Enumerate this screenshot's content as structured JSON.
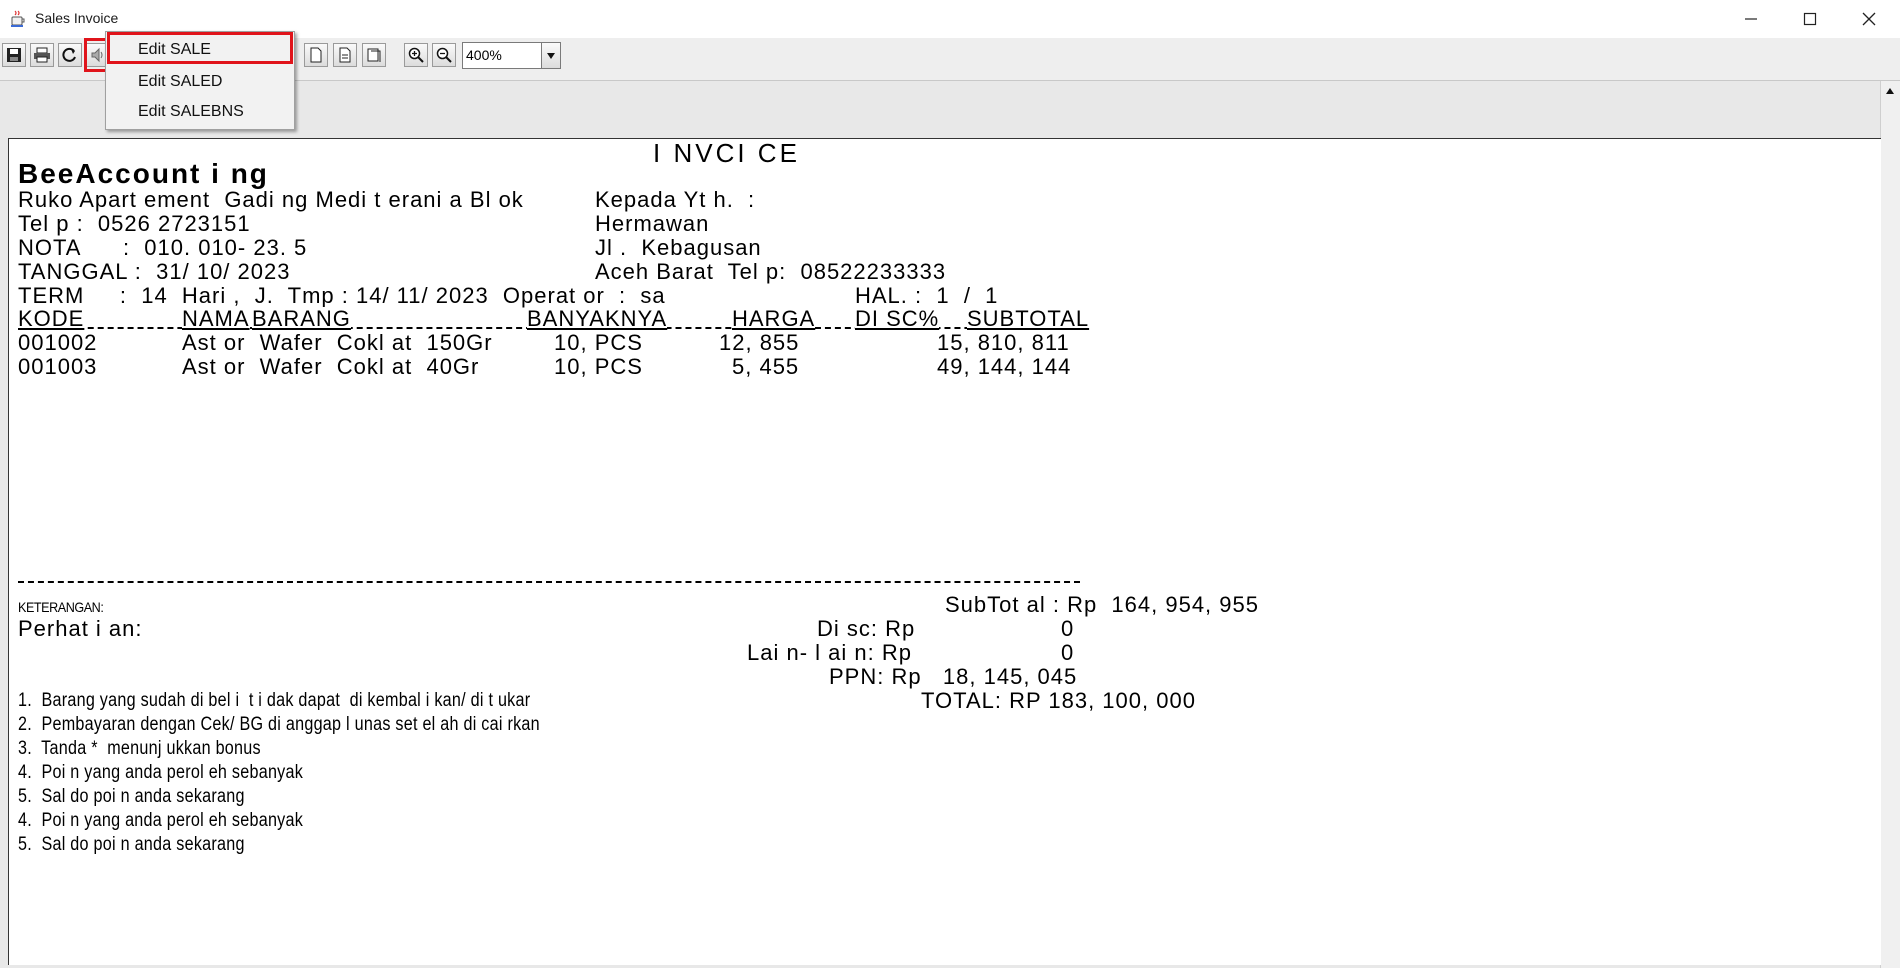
{
  "window": {
    "title": "Sales Invoice",
    "app_icon": "java-cup-icon",
    "controls": [
      "minimize-icon",
      "maximize-icon",
      "close-icon"
    ]
  },
  "toolbar": {
    "zoom_value": "400%",
    "buttons": [
      "save-icon",
      "print-icon",
      "refresh-icon",
      "speaker-icon",
      "page-first-icon",
      "page-current-icon",
      "page-last-icon",
      "zoom-in-icon",
      "zoom-out-icon"
    ]
  },
  "menu": {
    "items": [
      "Edit SALE",
      "Edit SALED",
      "Edit SALEBNS"
    ]
  },
  "invoice": {
    "heading": "I NVCI CE",
    "company": "BeeAccount i ng",
    "address": "Ruko Apart ement  Gadi ng Medi t erani a Bl ok",
    "phone": "Tel p :  0526 2723151",
    "nota": "NOTA      :  010. 010- 23. 5",
    "tanggal": "TANGGAL :  31/ 10/ 2023",
    "term": "TERM     :  14  Hari ,  J.  Tmp : 14/ 11/ 2023  Operat or  :  sa",
    "hal": "HAL. :  1  /  1",
    "to_label": "Kepada Yt h.  :",
    "to_name": "Hermawan",
    "to_street": "Jl .  Kebagusan",
    "to_city": "Aceh Barat  Tel p:  08522233333",
    "columns": {
      "kode": "KODE",
      "nama": "NAMA",
      "barang": "BARANG",
      "banyaknya": "BANYAKNYA",
      "harga": "HARGA",
      "disc": "DI SC%",
      "subtotal": "SUBTOTAL"
    },
    "rows": [
      {
        "kode": "001002",
        "nama": "Ast or  Wafer  Cokl at  150Gr",
        "qty": "10, PCS",
        "harga": "12, 855",
        "subtotal": "15, 810, 811"
      },
      {
        "kode": "001003",
        "nama": "Ast or  Wafer  Cokl at  40Gr",
        "qty": "10, PCS",
        "harga": "5, 455",
        "subtotal": "49, 144, 144"
      }
    ],
    "keterangan": "KETERANGAN:",
    "perhatian": "Perhat i an:",
    "totals": {
      "subtotal": "SubTot al : Rp  164, 954, 955",
      "disc_label": "Di sc: Rp",
      "disc_value": "0",
      "lain_label": "Lai n- l ai n: Rp",
      "lain_value": "0",
      "ppn": "PPN: Rp   18, 145, 045",
      "total": "TOTAL: RP 183, 100, 000"
    },
    "notes": [
      "1.  Barang yang sudah di bel i  t i dak dapat  di kembal i kan/ di t ukar",
      "2.  Pembayaran dengan Cek/ BG di anggap l unas set el ah di cai rkan",
      "3.  Tanda *  menunj ukkan bonus",
      "4.  Poi n yang anda perol eh sebanyak",
      "5.  Sal do poi n anda sekarang",
      "4.  Poi n yang anda perol eh sebanyak",
      "5.  Sal do poi n anda sekarang"
    ]
  },
  "colors": {
    "highlight": "#e0141b",
    "toolbar_bg": "#eeeeee",
    "preview_bg": "#e8e8e8"
  }
}
